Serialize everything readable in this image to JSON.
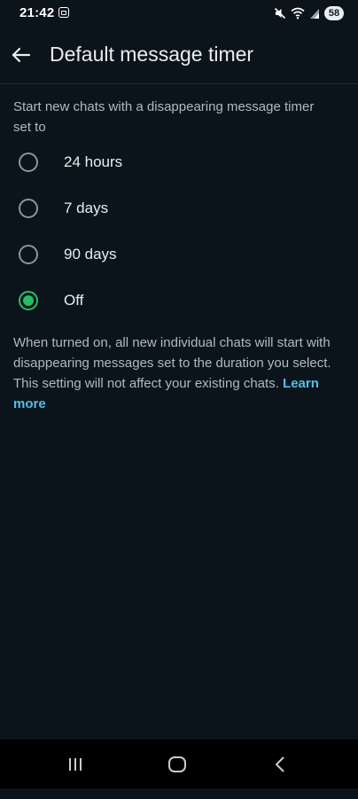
{
  "status_bar": {
    "time": "21:42",
    "battery": "58"
  },
  "app_bar": {
    "title": "Default message timer"
  },
  "section": {
    "header": "Start new chats with a disappearing message timer set to"
  },
  "options": [
    {
      "label": "24 hours",
      "selected": false
    },
    {
      "label": "7 days",
      "selected": false
    },
    {
      "label": "90 days",
      "selected": false
    },
    {
      "label": "Off",
      "selected": true
    }
  ],
  "description": {
    "text": "When turned on, all new individual chats will start with disappearing messages set to the duration you select. This setting will not affect your existing chats.",
    "link": "Learn more"
  },
  "colors": {
    "background": "#0b141a",
    "accent": "#21c063",
    "link": "#53bdeb"
  },
  "icons": {
    "back": "arrow-left-icon",
    "nav_recents": "recents-icon",
    "nav_home": "home-icon",
    "nav_back": "chevron-left-icon"
  }
}
